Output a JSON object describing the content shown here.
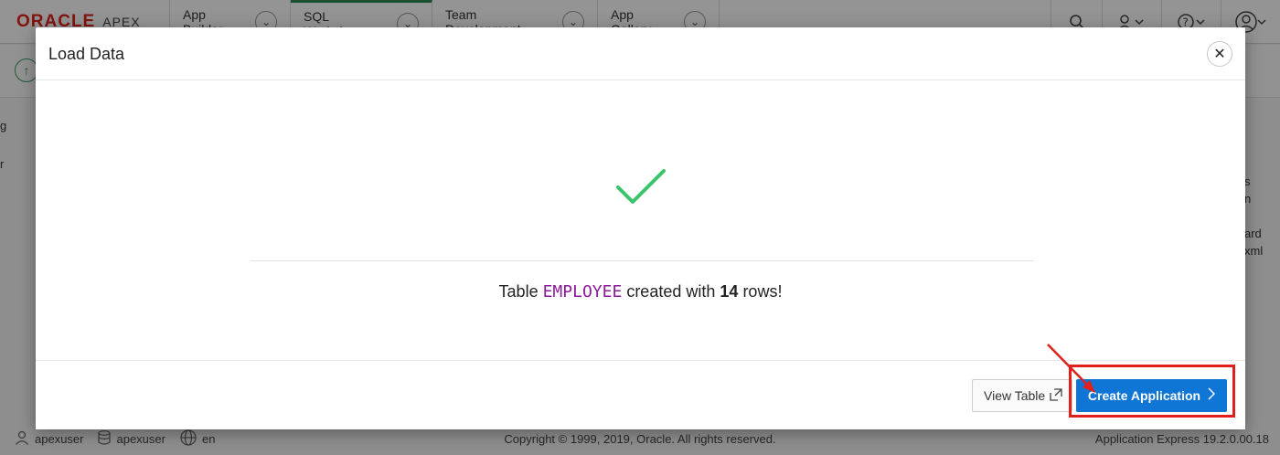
{
  "topbar": {
    "logo_oracle": "ORACLE",
    "logo_apex": "APEX",
    "tabs": [
      {
        "label": "App Builder"
      },
      {
        "label": "SQL Workshop"
      },
      {
        "label": "Team Development"
      },
      {
        "label": "App Gallery"
      }
    ]
  },
  "background_fragments": {
    "right_1": "s",
    "right_2": "n",
    "right_3": "ard",
    "right_4": "xml",
    "left_1": "g",
    "left_2": "r"
  },
  "dialog": {
    "title": "Load Data",
    "close_symbol": "✕",
    "result": {
      "prefix": "Table",
      "table_name": "EMPLOYEE",
      "middle": "created with",
      "row_count": "14",
      "suffix": "rows!"
    },
    "buttons": {
      "view_table": "View Table",
      "create_application": "Create Application"
    }
  },
  "footer": {
    "user": "apexuser",
    "schema": "apexuser",
    "language": "en",
    "copyright": "Copyright © 1999, 2019, Oracle. All rights reserved.",
    "version": "Application Express 19.2.0.00.18"
  },
  "colors": {
    "accent_blue": "#0f76d6",
    "success_green": "#3cc46b",
    "table_name_purple": "#8b1a98",
    "annotation_red": "#e0201a",
    "oracle_red": "#e2231a"
  }
}
